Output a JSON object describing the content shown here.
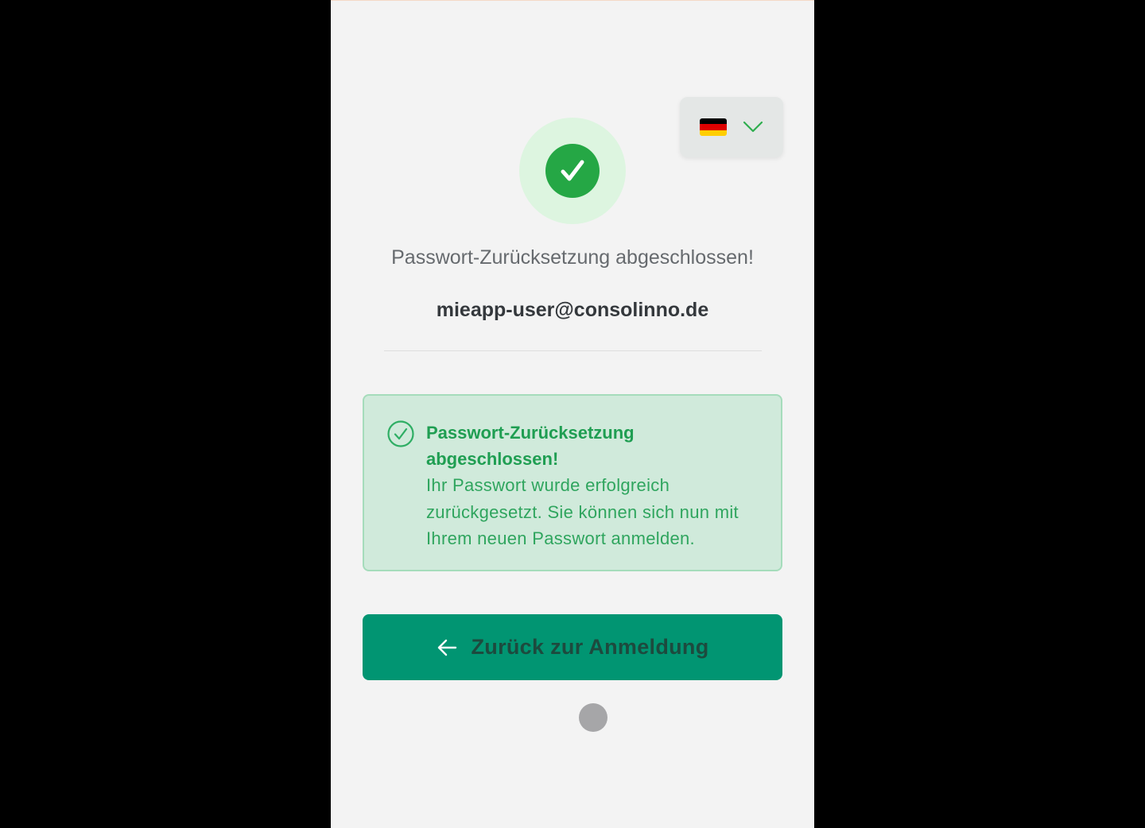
{
  "language_selector": {
    "selected_flag": "flag-germany-icon",
    "flag_colors": [
      "#000000",
      "#dd0000",
      "#ffce00"
    ],
    "chevron_icon": "chevron-down-icon",
    "chevron_color": "#2fae4f"
  },
  "status": {
    "icon": "check-circle-icon",
    "heading": "Passwort-Zurücksetzung abgeschlossen!",
    "email": "mieapp-user@consolinno.de"
  },
  "alert": {
    "icon": "check-circle-outline-icon",
    "title": "Passwort-Zurücksetzung abgeschlossen!",
    "message": "Ihr Passwort wurde erfolgreich zurückgesetzt. Sie können sich nun mit Ihrem neuen Passwort anmelden."
  },
  "actions": {
    "back_icon": "arrow-left-icon",
    "back_label": "Zurück zur Anmeldung"
  },
  "colors": {
    "primary": "#019572",
    "success": "#25a745",
    "alert_bg": "#d0eadb",
    "alert_text": "#1f9e52"
  }
}
